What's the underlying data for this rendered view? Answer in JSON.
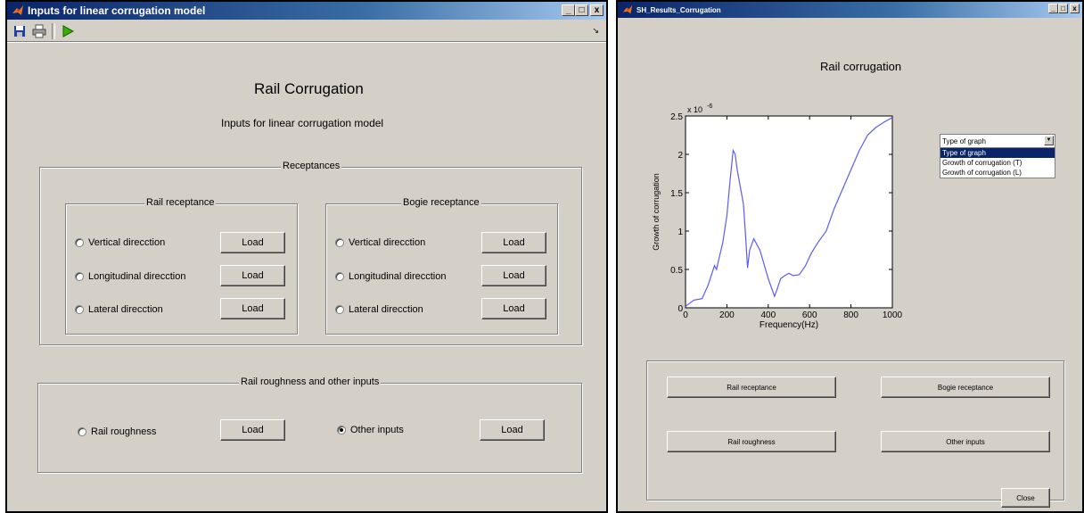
{
  "left_window": {
    "title": "Inputs for linear corrugation model",
    "toolbar": {
      "save": "save-icon",
      "print": "print-icon",
      "run": "run-icon",
      "dock": "↘"
    },
    "heading": "Rail Corrugation",
    "subheading": "Inputs for linear corrugation model",
    "receptances": {
      "legend": "Receptances",
      "rail": {
        "legend": "Rail receptance",
        "items": [
          {
            "label": "Vertical direcction",
            "button": "Load",
            "selected": false
          },
          {
            "label": "Longitudinal direcction",
            "button": "Load",
            "selected": false
          },
          {
            "label": "Lateral direcction",
            "button": "Load",
            "selected": false
          }
        ]
      },
      "bogie": {
        "legend": "Bogie receptance",
        "items": [
          {
            "label": "Vertical direcction",
            "button": "Load",
            "selected": false
          },
          {
            "label": "Longitudinal direcction",
            "button": "Load",
            "selected": false
          },
          {
            "label": "Lateral direcction",
            "button": "Load",
            "selected": false
          }
        ]
      }
    },
    "other": {
      "legend": "Rail roughness and other inputs",
      "roughness": {
        "label": "Rail roughness",
        "button": "Load",
        "selected": false
      },
      "other_inputs": {
        "label": "Other inputs",
        "button": "Load",
        "selected": true
      }
    }
  },
  "right_window": {
    "title": "SH_Results_Corrugation",
    "heading": "Rail corrugation",
    "dropdown": {
      "selected": "Type of graph",
      "options": [
        "Type of graph",
        "Growth of corrugation (T)",
        "Growth of corrugation (L)"
      ],
      "highlighted_index": 0
    },
    "buttons": {
      "rail_receptance": "Rail receptance",
      "bogie_receptance": "Bogie receptance",
      "rail_roughness": "Rail roughness",
      "other_inputs": "Other inputs",
      "close": "Close"
    }
  },
  "window_controls": {
    "minimize": "_",
    "maximize": "□",
    "close": "x"
  },
  "chart_data": {
    "type": "line",
    "title": "",
    "xlabel": "Frequency(Hz)",
    "ylabel": "Growth of corrugation",
    "y_multiplier": "x 10",
    "y_exponent": "-6",
    "xlim": [
      0,
      1000
    ],
    "ylim": [
      0,
      2.5
    ],
    "xticks": [
      "0",
      "200",
      "400",
      "600",
      "800",
      "1000"
    ],
    "yticks": [
      "0",
      "0.5",
      "1",
      "1.5",
      "2",
      "2.5"
    ],
    "line_color": "#5a5aff",
    "series": [
      {
        "x": [
          0,
          40,
          80,
          110,
          140,
          150,
          160,
          180,
          200,
          215,
          230,
          240,
          250,
          260,
          280,
          290,
          300,
          310,
          330,
          360,
          400,
          430,
          440,
          460,
          480,
          500,
          520,
          550,
          580,
          610,
          640,
          680,
          720,
          760,
          800,
          840,
          880,
          920,
          960,
          1000
        ],
        "y": [
          0.02,
          0.1,
          0.12,
          0.3,
          0.55,
          0.5,
          0.62,
          0.85,
          1.2,
          1.65,
          2.05,
          2.0,
          1.8,
          1.65,
          1.35,
          0.95,
          0.52,
          0.75,
          0.9,
          0.75,
          0.38,
          0.15,
          0.22,
          0.38,
          0.42,
          0.45,
          0.42,
          0.43,
          0.55,
          0.72,
          0.85,
          1.0,
          1.3,
          1.55,
          1.8,
          2.05,
          2.25,
          2.35,
          2.42,
          2.48
        ]
      }
    ]
  }
}
